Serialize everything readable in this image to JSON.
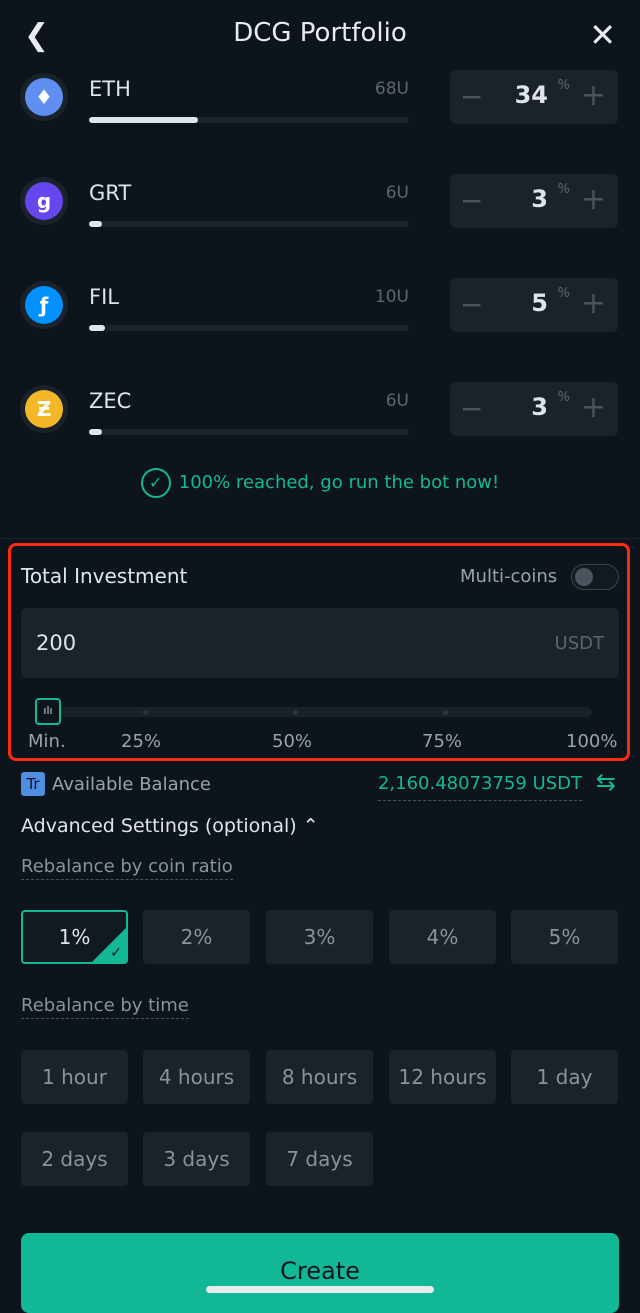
{
  "header": {
    "title": "DCG Portfolio",
    "back_icon": "chevron-left-icon",
    "close_icon": "close-icon"
  },
  "coins": [
    {
      "symbol": "ETH",
      "amount": "68U",
      "percent": "34",
      "fill": 34,
      "color": "#5f8ff0",
      "glyph": "♦"
    },
    {
      "symbol": "GRT",
      "amount": "6U",
      "percent": "3",
      "fill": 3,
      "color": "#6747ed",
      "glyph": "g"
    },
    {
      "symbol": "FIL",
      "amount": "10U",
      "percent": "5",
      "fill": 5,
      "color": "#0090ff",
      "glyph": "ƒ"
    },
    {
      "symbol": "ZEC",
      "amount": "6U",
      "percent": "3",
      "fill": 3,
      "color": "#f4b728",
      "glyph": "Ƶ"
    }
  ],
  "percent_unit": "%",
  "status_message": "100% reached, go run the bot now!",
  "investment": {
    "title": "Total Investment",
    "multi_coins_label": "Multi-coins",
    "multi_coins_on": false,
    "value": "200",
    "unit": "USDT",
    "slider_percent": 0,
    "slider_labels": [
      "Min.",
      "25%",
      "50%",
      "75%",
      "100%"
    ]
  },
  "balance": {
    "label": "Available Balance",
    "value": "2,160.48073759 USDT",
    "badge": "Tr"
  },
  "advanced": {
    "title": "Advanced Settings (optional)",
    "expanded": true
  },
  "ratio": {
    "label": "Rebalance by coin ratio",
    "options": [
      "1%",
      "2%",
      "3%",
      "4%",
      "5%"
    ],
    "selected": "1%"
  },
  "time": {
    "label": "Rebalance by time",
    "options": [
      "1 hour",
      "4 hours",
      "8 hours",
      "12 hours",
      "1 day",
      "2 days",
      "3 days",
      "7 days"
    ]
  },
  "create_label": "Create",
  "colors": {
    "accent": "#14b894",
    "highlight": "#ff2a12",
    "background": "#0d141c"
  }
}
